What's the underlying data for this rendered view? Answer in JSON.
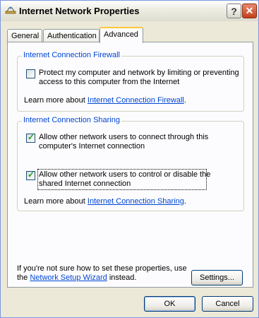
{
  "window": {
    "title": "Internet Network Properties"
  },
  "tabs": [
    {
      "label": "General"
    },
    {
      "label": "Authentication"
    },
    {
      "label": "Advanced"
    }
  ],
  "firewall": {
    "group_title": "Internet Connection Firewall",
    "checkbox_line1": "Protect my computer and network by limiting or preventing",
    "checkbox_line2": "access to this computer from the Internet",
    "checked": false,
    "learn_prefix": "Learn more about ",
    "learn_link": "Internet Connection Firewall",
    "learn_suffix": "."
  },
  "sharing": {
    "group_title": "Internet Connection Sharing",
    "opt1_line1": "Allow other network users to connect through this",
    "opt1_line2": "computer's Internet connection",
    "opt1_checked": true,
    "opt2_line1": "Allow other network users to control or disable the",
    "opt2_line2": "shared Internet connection",
    "opt2_checked": true,
    "learn_prefix": "Learn more about ",
    "learn_link": "Internet Connection Sharing",
    "learn_suffix": "."
  },
  "footer": {
    "note_line1": "If you're not sure how to set these properties, use",
    "note_prefix": "the ",
    "note_link": "Network Setup Wizard",
    "note_suffix": " instead.",
    "settings_label": "Settings..."
  },
  "buttons": {
    "ok": "OK",
    "cancel": "Cancel"
  }
}
